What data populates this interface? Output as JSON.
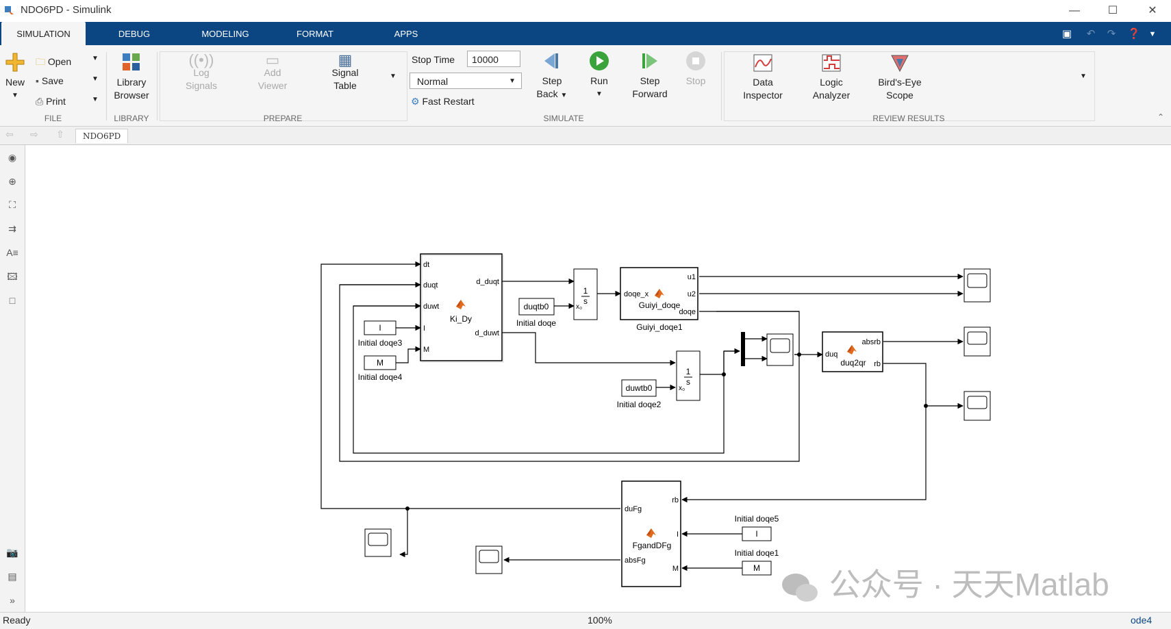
{
  "window": {
    "title": "NDO6PD - Simulink"
  },
  "tabs": [
    {
      "label": "SIMULATION"
    },
    {
      "label": "DEBUG"
    },
    {
      "label": "MODELING"
    },
    {
      "label": "FORMAT"
    },
    {
      "label": "APPS"
    }
  ],
  "ribbon": {
    "file": {
      "new": "New",
      "open": "Open",
      "save": "Save",
      "print": "Print",
      "label": "FILE"
    },
    "library": {
      "browser_line1": "Library",
      "browser_line2": "Browser",
      "label": "LIBRARY"
    },
    "prepare": {
      "log1": "Log",
      "log2": "Signals",
      "add1": "Add",
      "add2": "Viewer",
      "sig1": "Signal",
      "sig2": "Table",
      "label": "PREPARE"
    },
    "simulate": {
      "stop_time_label": "Stop Time",
      "stop_time_value": "10000",
      "mode": "Normal",
      "fast_restart": "Fast Restart",
      "step_back1": "Step",
      "step_back2": "Back",
      "run": "Run",
      "step_fwd1": "Step",
      "step_fwd2": "Forward",
      "stop": "Stop",
      "label": "SIMULATE"
    },
    "review": {
      "di1": "Data",
      "di2": "Inspector",
      "la1": "Logic",
      "la2": "Analyzer",
      "be1": "Bird's-Eye",
      "be2": "Scope",
      "label": "REVIEW RESULTS"
    }
  },
  "breadcrumb": "NDO6PD",
  "diagram": {
    "ki_dy": {
      "name": "Ki_Dy",
      "in": [
        "dt",
        "duqt",
        "duwt",
        "I",
        "M"
      ],
      "out": [
        "d_duqt",
        "d_duwt"
      ]
    },
    "guiyi": {
      "name": "Guiyi_doqe",
      "caption": "Guiyi_doqe1",
      "in": "doqe_x",
      "out": [
        "u1",
        "u2",
        "doqe"
      ]
    },
    "duq2qr": {
      "name": "duq2qr",
      "in": "duq",
      "out": [
        "absrb",
        "rb"
      ]
    },
    "fgand": {
      "name": "FgandDFg",
      "in": [
        "rb",
        "I",
        "M"
      ],
      "out": [
        "duFg",
        "absFg"
      ]
    },
    "integrator": {
      "num": "1",
      "den": "s",
      "x0": "x₀"
    },
    "consts": [
      {
        "value": "duqtb0",
        "caption": "Initial doqe"
      },
      {
        "value": "duwtb0",
        "caption": "Initial doqe2"
      },
      {
        "value": "I",
        "caption": "Initial doqe3"
      },
      {
        "value": "M",
        "caption": "Initial doqe4"
      },
      {
        "value": "I",
        "caption": "Initial doqe5"
      },
      {
        "value": "M",
        "caption": "Initial doqe1"
      }
    ]
  },
  "status": {
    "left": "Ready",
    "zoom": "100%",
    "solver": "ode4"
  },
  "watermark": "公众号 · 天天Matlab"
}
